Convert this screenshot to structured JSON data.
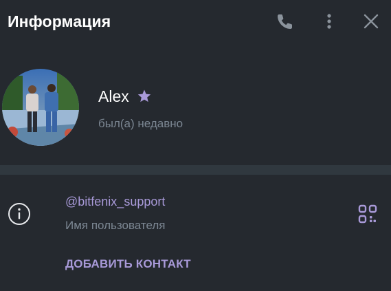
{
  "header": {
    "title": "Информация",
    "icons": [
      "phone-icon",
      "more-vertical-icon",
      "close-icon"
    ]
  },
  "profile": {
    "name": "Alex",
    "badge_icon": "star-icon",
    "status": "был(а) недавно"
  },
  "info": {
    "icon": "info-icon",
    "username": "@bitfenix_support",
    "username_label": "Имя пользователя",
    "qr_icon": "qr-code-icon",
    "add_contact_label": "ДОБАВИТЬ КОНТАКТ"
  },
  "colors": {
    "background": "#25292f",
    "divider": "#30383f",
    "accent": "#a99ad9",
    "muted_text": "#7c8793",
    "icon": "#8b939c"
  }
}
